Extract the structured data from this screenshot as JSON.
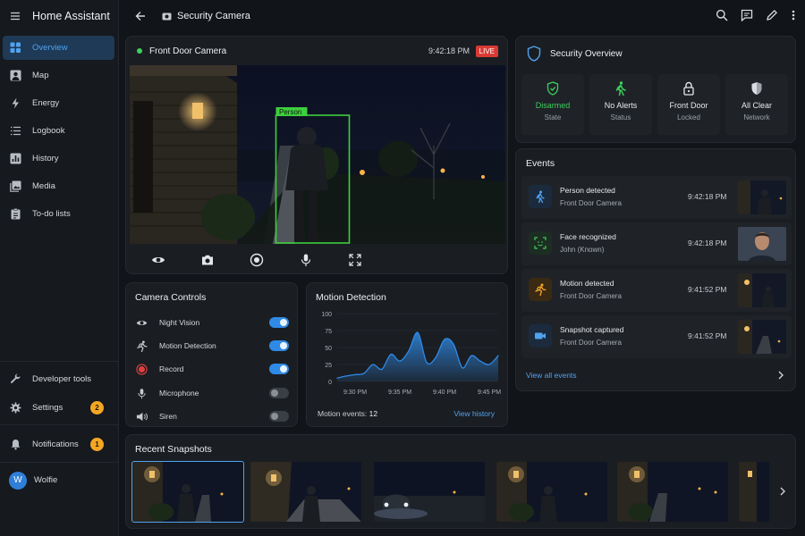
{
  "app": {
    "title": "Home Assistant"
  },
  "sidebar": {
    "items": [
      {
        "label": "Overview",
        "icon": "grid-icon",
        "active": true
      },
      {
        "label": "Map",
        "icon": "map-person-icon"
      },
      {
        "label": "Energy",
        "icon": "lightning-icon"
      },
      {
        "label": "Logbook",
        "icon": "list-icon"
      },
      {
        "label": "History",
        "icon": "chart-box-icon"
      },
      {
        "label": "Media",
        "icon": "image-multiple-icon"
      },
      {
        "label": "To-do lists",
        "icon": "clipboard-list-icon"
      }
    ],
    "bottom": {
      "developer_tools": "Developer tools",
      "settings": "Settings",
      "settings_badge": "2",
      "notifications": "Notifications",
      "notifications_badge": "1",
      "user_name": "Wolfie",
      "user_initial": "W"
    }
  },
  "topbar": {
    "title": "Security Camera"
  },
  "camera": {
    "name": "Front Door Camera",
    "time": "9:42:18 PM",
    "live": "LIVE",
    "detection_label": "Person",
    "controls": [
      "eye-icon",
      "camera-icon",
      "record-icon",
      "microphone-icon",
      "fullscreen-icon"
    ]
  },
  "security": {
    "title": "Security Overview",
    "tiles": [
      {
        "value": "Disarmed",
        "label": "State",
        "icon": "shield-check-icon",
        "color": "#3ecf5c"
      },
      {
        "value": "No Alerts",
        "label": "Status",
        "icon": "walking-person-icon",
        "color": "#e6e8eb"
      },
      {
        "value": "Front Door",
        "label": "Locked",
        "icon": "lock-icon",
        "color": "#e6e8eb"
      },
      {
        "value": "All Clear",
        "label": "Network",
        "icon": "shield-icon",
        "color": "#e6e8eb"
      }
    ]
  },
  "events": {
    "title": "Events",
    "items": [
      {
        "title": "Person detected",
        "subtitle": "Front Door Camera",
        "time": "9:42:18 PM",
        "icon": "walking-person-icon"
      },
      {
        "title": "Face recognized",
        "subtitle": "John (Known)",
        "time": "9:42:18 PM",
        "icon": "face-recognition-icon"
      },
      {
        "title": "Motion detected",
        "subtitle": "Front Door Camera",
        "time": "9:41:52 PM",
        "icon": "running-person-icon"
      },
      {
        "title": "Snapshot captured",
        "subtitle": "Front Door Camera",
        "time": "9:41:52 PM",
        "icon": "video-camera-icon"
      }
    ],
    "view_all": "View all events"
  },
  "camera_controls": {
    "title": "Camera Controls",
    "items": [
      {
        "label": "Night Vision",
        "on": true,
        "icon": "eye-icon"
      },
      {
        "label": "Motion Detection",
        "on": true,
        "icon": "running-person-icon"
      },
      {
        "label": "Record",
        "on": true,
        "icon": "record-icon"
      },
      {
        "label": "Microphone",
        "on": false,
        "icon": "microphone-icon"
      },
      {
        "label": "Siren",
        "on": false,
        "icon": "speaker-icon"
      }
    ]
  },
  "motion": {
    "title": "Motion Detection",
    "events_label": "Motion events:",
    "events_count": "12",
    "view_history": "View history"
  },
  "chart_data": {
    "type": "area",
    "title": "Motion Detection",
    "xlabel": "",
    "ylabel": "",
    "ylim": [
      0,
      100
    ],
    "yticks": [
      0,
      25,
      50,
      75,
      100
    ],
    "xticks": [
      "9:30 PM",
      "9:35 PM",
      "9:40 PM",
      "9:45 PM"
    ],
    "x_minutes": [
      0,
      1,
      2,
      3,
      4,
      5,
      6,
      7,
      8,
      9,
      10,
      11,
      12,
      13,
      14,
      15,
      16,
      17,
      18
    ],
    "x": [
      "9:28 PM",
      "9:29 PM",
      "9:30 PM",
      "9:31 PM",
      "9:32 PM",
      "9:33 PM",
      "9:34 PM",
      "9:35 PM",
      "9:36 PM",
      "9:37 PM",
      "9:38 PM",
      "9:39 PM",
      "9:40 PM",
      "9:41 PM",
      "9:42 PM",
      "9:43 PM",
      "9:44 PM",
      "9:45 PM",
      "9:46 PM"
    ],
    "values": [
      5,
      8,
      10,
      12,
      25,
      18,
      40,
      30,
      45,
      72,
      28,
      35,
      62,
      55,
      20,
      38,
      30,
      25,
      38
    ],
    "color": "#2f8ae6"
  },
  "snapshots": {
    "title": "Recent Snapshots",
    "count": 6
  }
}
